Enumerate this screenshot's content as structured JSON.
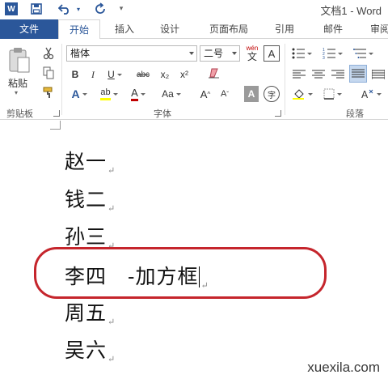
{
  "titlebar": {
    "word_logo": "W",
    "doc_title": "文档1 - Word"
  },
  "tabs": [
    {
      "label": "文件"
    },
    {
      "label": "开始"
    },
    {
      "label": "插入"
    },
    {
      "label": "设计"
    },
    {
      "label": "页面布局"
    },
    {
      "label": "引用"
    },
    {
      "label": "邮件"
    },
    {
      "label": "审阅"
    }
  ],
  "ribbon": {
    "clipboard": {
      "paste_label": "粘贴",
      "group_label": "剪贴板"
    },
    "font": {
      "font_name": "楷体",
      "font_size": "二号",
      "phonetic": "wén",
      "border_char": "A",
      "group_label": "字体",
      "bold": "B",
      "italic": "I",
      "underline": "U",
      "strikethrough": "abc",
      "subscript": "x₂",
      "superscript": "x²",
      "effects": "A",
      "highlight": "ab",
      "font_color": "A",
      "change_case": "Aa",
      "grow": "A",
      "shrink": "A",
      "shade": "A",
      "enclose": "字"
    },
    "paragraph": {
      "group_label": "段落"
    }
  },
  "document": {
    "lines": [
      {
        "text": "赵一"
      },
      {
        "text": "钱二"
      },
      {
        "text": "孙三"
      },
      {
        "text": "李四　-加方框"
      },
      {
        "text": "周五"
      },
      {
        "text": "吴六"
      }
    ],
    "paragraph_mark": "↵"
  },
  "colors": {
    "accent": "#2b579a",
    "annotation_circle": "#c5252c",
    "font_color_bar": "#c00000",
    "highlight_bar": "#ffff00"
  },
  "watermark": "xuexila.com"
}
